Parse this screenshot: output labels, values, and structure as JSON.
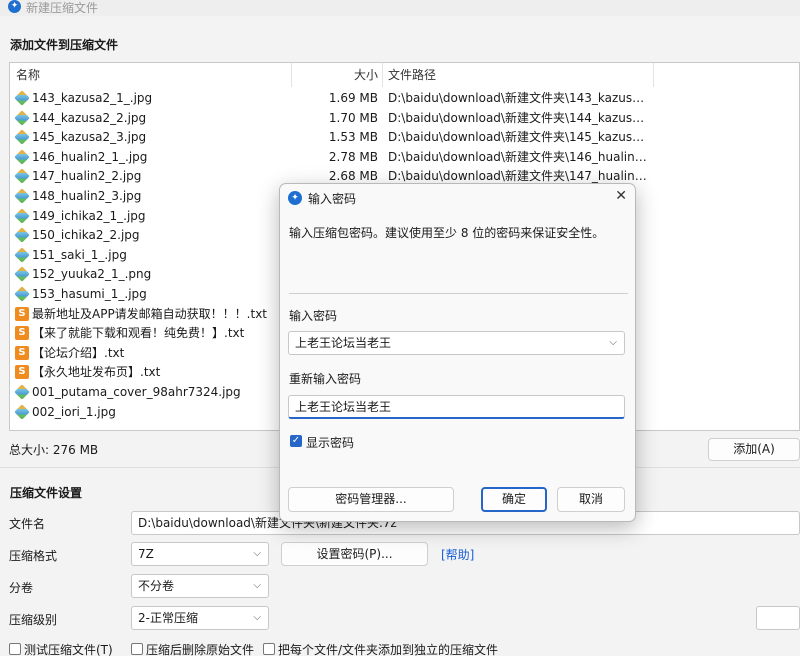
{
  "window": {
    "title": "新建压缩文件"
  },
  "add_section": {
    "title": "添加文件到压缩文件"
  },
  "table": {
    "columns": {
      "name": "名称",
      "size": "大小",
      "path": "文件路径"
    },
    "rows": [
      {
        "name": "143_kazusa2_1_.jpg",
        "size": "1.69 MB",
        "path": "D:\\baidu\\download\\新建文件夹\\143_kazusa2_1...",
        "type": "image"
      },
      {
        "name": "144_kazusa2_2.jpg",
        "size": "1.70 MB",
        "path": "D:\\baidu\\download\\新建文件夹\\144_kazusa2_2...",
        "type": "image"
      },
      {
        "name": "145_kazusa2_3.jpg",
        "size": "1.53 MB",
        "path": "D:\\baidu\\download\\新建文件夹\\145_kazusa2_3...",
        "type": "image"
      },
      {
        "name": "146_hualin2_1_.jpg",
        "size": "2.78 MB",
        "path": "D:\\baidu\\download\\新建文件夹\\146_hualin2_1_...",
        "type": "image"
      },
      {
        "name": "147_hualin2_2.jpg",
        "size": "2.68 MB",
        "path": "D:\\baidu\\download\\新建文件夹\\147_hualin2_2.j...",
        "type": "image"
      },
      {
        "name": "148_hualin2_3.jpg",
        "size": "",
        "path": "",
        "type": "image"
      },
      {
        "name": "149_ichika2_1_.jpg",
        "size": "",
        "path": "",
        "type": "image"
      },
      {
        "name": "150_ichika2_2.jpg",
        "size": "",
        "path": "",
        "type": "image"
      },
      {
        "name": "151_saki_1_.jpg",
        "size": "",
        "path": "",
        "type": "image"
      },
      {
        "name": "152_yuuka2_1_.png",
        "size": "",
        "path": "",
        "type": "image"
      },
      {
        "name": "153_hasumi_1_.jpg",
        "size": "",
        "path": "",
        "type": "image"
      },
      {
        "name": "最新地址及APP请发邮箱自动获取！！！.txt",
        "size": "",
        "path": "",
        "type": "text"
      },
      {
        "name": "【来了就能下载和观看！纯免费！】.txt",
        "size": "",
        "path": "",
        "type": "text"
      },
      {
        "name": "【论坛介绍】.txt",
        "size": "",
        "path": "",
        "type": "text"
      },
      {
        "name": "【永久地址发布页】.txt",
        "size": "",
        "path": "",
        "type": "text"
      },
      {
        "name": "001_putama_cover_98ahr7324.jpg",
        "size": "",
        "path": "",
        "type": "image"
      },
      {
        "name": "002_iori_1.jpg",
        "size": "",
        "path": "",
        "type": "image"
      }
    ]
  },
  "total_size": "总大小: 276 MB",
  "add_button": "添加(A)",
  "settings": {
    "title": "压缩文件设置",
    "filename_label": "文件名",
    "filename_value": "D:\\baidu\\download\\新建文件夹\\新建文件夹.7z",
    "format_label": "压缩格式",
    "format_value": "7Z",
    "set_password_button": "设置密码(P)...",
    "help_link": "[帮助]",
    "split_label": "分卷",
    "split_value": "不分卷",
    "level_label": "压缩级别",
    "level_value": "2-正常压缩",
    "check_test": "测试压缩文件(T)",
    "check_delete": "压缩后删除原始文件",
    "check_each": "把每个文件/文件夹添加到独立的压缩文件"
  },
  "dialog": {
    "title": "输入密码",
    "description": "输入压缩包密码。建议使用至少 8 位的密码来保证安全性。",
    "password_label": "输入密码",
    "password_value": "上老王论坛当老王",
    "reenter_label": "重新输入密码",
    "reenter_value": "上老王论坛当老王",
    "show_password_label": "显示密码",
    "show_password_checked": true,
    "manager_button": "密码管理器...",
    "ok_button": "确定",
    "cancel_button": "取消"
  },
  "colors": {
    "accent": "#2566c8",
    "link": "#1a5fd6",
    "txt_icon": "#f08b1f"
  }
}
